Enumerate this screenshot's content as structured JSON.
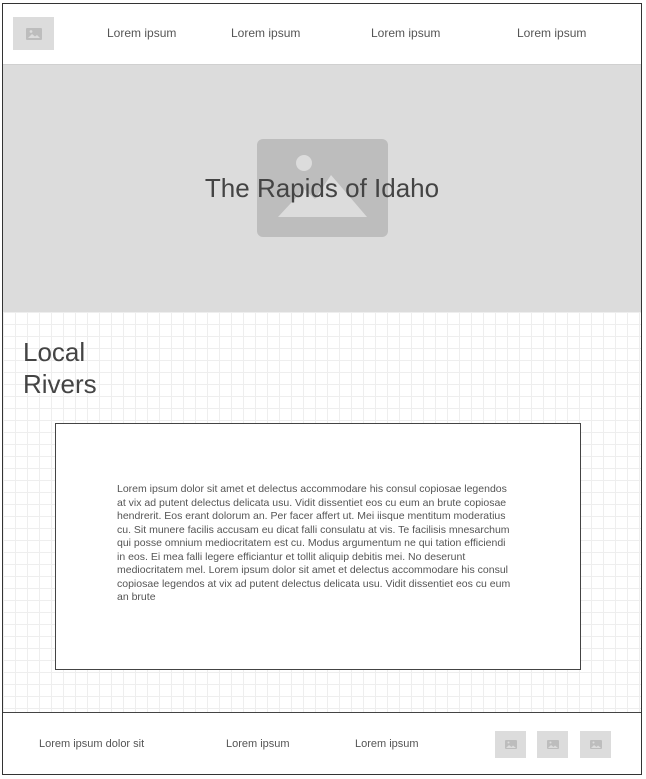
{
  "header": {
    "logo_icon": "image-placeholder-icon",
    "nav": [
      {
        "label": "Lorem ipsum"
      },
      {
        "label": "Lorem ipsum"
      },
      {
        "label": "Lorem ipsum"
      },
      {
        "label": "Lorem ipsum"
      }
    ]
  },
  "hero": {
    "image_icon": "image-placeholder-icon",
    "title": "The Rapids of Idaho"
  },
  "section": {
    "title_line1": "Local",
    "title_line2": "Rivers",
    "body": "Lorem ipsum dolor sit amet et delectus accommodare his consul copiosae legendos at vix ad putent delectus delicata usu. Vidit dissentiet eos cu eum an brute copiosae hendrerit. Eos erant dolorum an. Per facer affert ut. Mei iisque mentitum moderatius cu. Sit munere facilis accusam eu dicat falli consulatu at vis. Te facilisis mnesarchum qui posse omnium mediocritatem est cu. Modus argumentum ne qui tation efficiendi in eos. Ei mea falli legere efficiantur et tollit aliquip debitis mei. No deserunt mediocritatem mel. Lorem ipsum dolor sit amet et delectus accommodare his consul copiosae legendos at vix ad putent delectus delicata usu. Vidit dissentiet eos cu eum an brute"
  },
  "footer": {
    "links": [
      {
        "label": "Lorem ipsum dolor sit"
      },
      {
        "label": "Lorem ipsum"
      },
      {
        "label": "Lorem ipsum"
      }
    ],
    "social_icons": [
      "image-placeholder-icon",
      "image-placeholder-icon",
      "image-placeholder-icon"
    ]
  },
  "colors": {
    "placeholder_bg": "#dcdcdc",
    "placeholder_icon": "#bdbdbd",
    "text": "#444444",
    "border": "#333333"
  }
}
